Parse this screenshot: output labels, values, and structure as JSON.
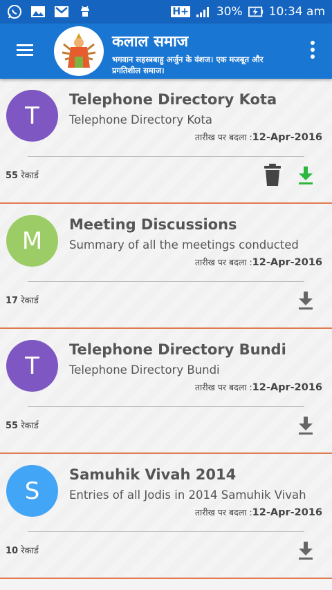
{
  "status_bar": {
    "network": "H+",
    "battery": "30%",
    "time": "10:34 am"
  },
  "header": {
    "title": "कलाल समाज",
    "subtitle": "भगवान सहस्त्रबाहु अर्जुन के वंशज। एक मजबूत और प्रगतिशील समाज।"
  },
  "cards": [
    {
      "avatar_letter": "T",
      "avatar_color": "#7e57c2",
      "title": "Telephone Directory Kota",
      "description": "Telephone Directory Kota",
      "date_label": "तारीख पर बदला :",
      "date": "12-Apr-2016",
      "count": "55",
      "count_label": "रेकार्ड",
      "downloaded": true
    },
    {
      "avatar_letter": "M",
      "avatar_color": "#9ccc65",
      "title": "Meeting Discussions",
      "description": "Summary of all the meetings conducted",
      "date_label": "तारीख पर बदला :",
      "date": "12-Apr-2016",
      "count": "17",
      "count_label": "रेकार्ड",
      "downloaded": false
    },
    {
      "avatar_letter": "T",
      "avatar_color": "#7e57c2",
      "title": "Telephone Directory Bundi",
      "description": "Telephone Directory Bundi",
      "date_label": "तारीख पर बदला :",
      "date": "12-Apr-2016",
      "count": "55",
      "count_label": "रेकार्ड",
      "downloaded": false
    },
    {
      "avatar_letter": "S",
      "avatar_color": "#42a5f5",
      "title": "Samuhik Vivah 2014",
      "description": "Entries of all Jodis in 2014 Samuhik Vivah",
      "date_label": "तारीख पर बदला :",
      "date": "12-Apr-2016",
      "count": "10",
      "count_label": "रेकार्ड",
      "downloaded": false
    }
  ],
  "icons": {
    "menu": "hamburger-menu-icon",
    "more": "more-vert-icon",
    "delete": "trash-icon",
    "download": "download-icon"
  },
  "colors": {
    "app_bar": "#1976d2",
    "status_bar": "#1565c0",
    "divider": "#e07a50",
    "download_active": "#2db83d",
    "download_inactive": "#666666"
  }
}
